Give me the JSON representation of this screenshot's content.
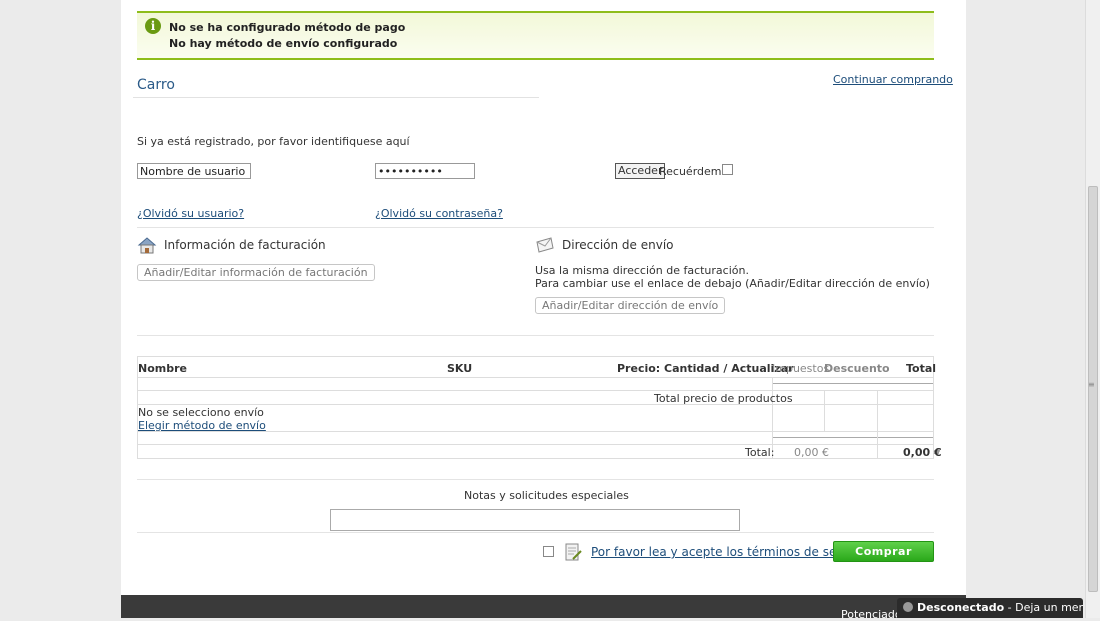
{
  "notices": {
    "payment": "No se ha configurado método de pago",
    "shipping": "No hay método de envío configurado"
  },
  "cart": {
    "title": "Carro",
    "continue_link": "Continuar comprando"
  },
  "login": {
    "prompt": "Si ya está registrado, por favor identifiquese aquí",
    "username_value": "Nombre de usuario",
    "password_value": "••••••••••",
    "submit_label": "Acceder",
    "remember_label": "Recuérdeme",
    "forgot_username": "¿Olvidó su usuario?",
    "forgot_password": "¿Olvidó su contraseña?"
  },
  "billing": {
    "title": "Información de facturación",
    "button": "Añadir/Editar información de facturación"
  },
  "shipping": {
    "title": "Dirección de envío",
    "note_line1": "Usa la misma dirección de facturación.",
    "note_line2": "Para cambiar use el enlace de debajo (Añadir/Editar dirección de envío)",
    "button": "Añadir/Editar dirección de envío"
  },
  "table": {
    "headers": {
      "name": "Nombre",
      "sku": "SKU",
      "price": "Precio:",
      "qty": "Cantidad / Actualizar",
      "tax": "Impuestos",
      "discount": "Descuento",
      "total": "Total"
    },
    "products_total_label": "Total precio de productos",
    "no_shipping": "No se selecciono envío",
    "choose_shipping": "Elegir método de envío",
    "total_label": "Total:",
    "tax_total": "0,00 €",
    "grand_total": "0,00 €"
  },
  "notes": {
    "label": "Notas y solicitudes especiales"
  },
  "terms": {
    "link": "Por favor lea y acepte los términos de servicio.",
    "buy_button": "Comprar ahora"
  },
  "footer": {
    "powered": "Potenciado"
  },
  "chat": {
    "status": "Desconectado",
    "message": "- Deja un mensaje"
  }
}
